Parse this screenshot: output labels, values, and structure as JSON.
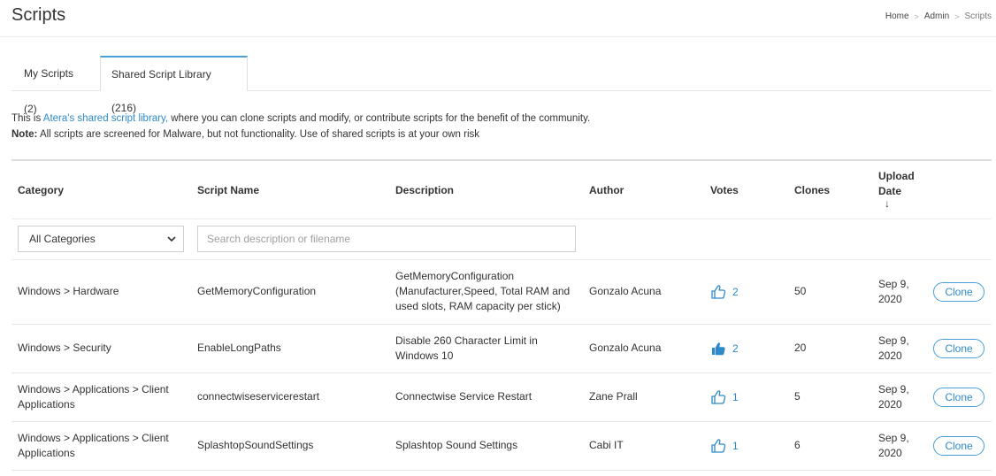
{
  "header": {
    "title": "Scripts",
    "breadcrumb": [
      "Home",
      "Admin",
      "Scripts"
    ],
    "separator": ">"
  },
  "tabs": [
    {
      "label": "My Scripts (2)"
    },
    {
      "label": "Shared Script Library (216)"
    }
  ],
  "intro": {
    "line1_prefix": "This is ",
    "line1_link": "Atera's shared script library,",
    "line1_suffix": " where you can clone scripts and modify, or contribute scripts for the benefit of the community.",
    "note_label": "Note:",
    "note_text": " All scripts are screened for Malware, but not functionality. Use of shared scripts is at your own risk"
  },
  "table": {
    "headers": {
      "category": "Category",
      "script_name": "Script Name",
      "description": "Description",
      "author": "Author",
      "votes": "Votes",
      "clones": "Clones",
      "upload_date": "Upload Date",
      "sort_arrow": "↓"
    },
    "filters": {
      "category_selected": "All Categories",
      "search_placeholder": "Search description or filename"
    },
    "clone_label": "Clone",
    "rows": [
      {
        "category": "Windows > Hardware",
        "script_name": "GetMemoryConfiguration",
        "description": "GetMemoryConfiguration (Manufacturer,Speed, Total RAM and used slots, RAM capacity per stick)",
        "author": "Gonzalo Acuna",
        "votes": "2",
        "voted": false,
        "clones": "50",
        "date": "Sep 9, 2020"
      },
      {
        "category": "Windows > Security",
        "script_name": "EnableLongPaths",
        "description": "Disable 260 Character Limit in Windows 10",
        "author": "Gonzalo Acuna",
        "votes": "2",
        "voted": true,
        "clones": "20",
        "date": "Sep 9, 2020"
      },
      {
        "category": "Windows > Applications > Client Applications",
        "script_name": "connectwiseservicerestart",
        "description": "Connectwise Service Restart",
        "author": "Zane Prall",
        "votes": "1",
        "voted": false,
        "clones": "5",
        "date": "Sep 9, 2020"
      },
      {
        "category": "Windows > Applications > Client Applications",
        "script_name": "SplashtopSoundSettings",
        "description": "Splashtop Sound Settings",
        "author": "Cabi IT",
        "votes": "1",
        "voted": false,
        "clones": "6",
        "date": "Sep 9, 2020"
      }
    ]
  },
  "colors": {
    "accent": "#2f8ac9",
    "tab_active_border": "#4a9fd8"
  },
  "icons": {
    "vote": "thumbs-up-icon",
    "select": "chevron-down-icon"
  }
}
